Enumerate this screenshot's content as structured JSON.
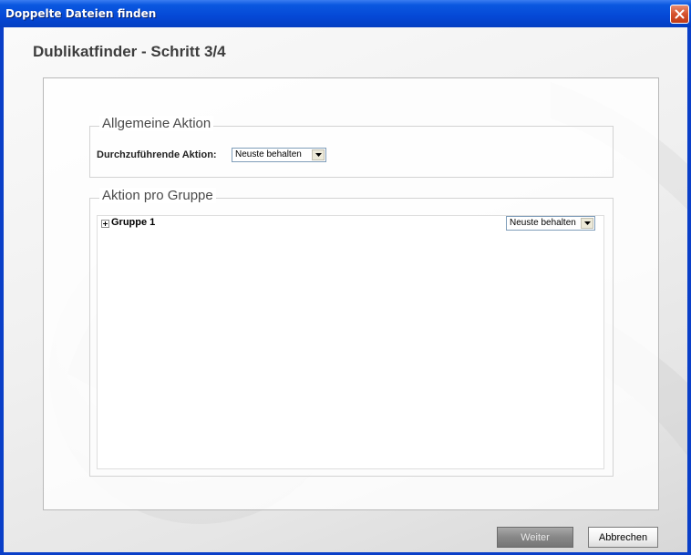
{
  "window": {
    "title": "Doppelte Dateien finden"
  },
  "wizard": {
    "step_title": "Dublikatfinder - Schritt 3/4"
  },
  "general_action": {
    "legend": "Allgemeine Aktion",
    "label": "Durchzuführende Aktion:",
    "selected": "Neuste behalten"
  },
  "group_action": {
    "legend": "Aktion pro Gruppe",
    "groups": [
      {
        "label": "Gruppe 1",
        "selected": "Neuste behalten"
      }
    ]
  },
  "buttons": {
    "next": "Weiter",
    "cancel": "Abbrechen"
  },
  "colors": {
    "titlebar": "#0548d6",
    "close": "#d5522d",
    "accent_border": "#7f9db9"
  },
  "icons": [
    "close-icon",
    "expand-plus-icon",
    "dropdown-arrow-icon"
  ]
}
